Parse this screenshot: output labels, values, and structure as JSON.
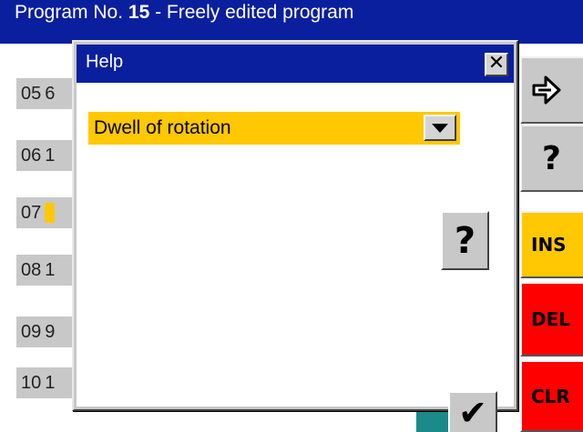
{
  "program": {
    "label": "Program No.",
    "number": "15",
    "name": "- Freely edited program"
  },
  "rows": [
    {
      "index": "05",
      "value": "6"
    },
    {
      "index": "06",
      "value": "1"
    },
    {
      "index": "07",
      "value": "l",
      "highlight": true
    },
    {
      "index": "08",
      "value": "1"
    },
    {
      "index": "09",
      "value": "9"
    },
    {
      "index": "10",
      "value": "1"
    }
  ],
  "side_buttons": {
    "enter_icon": "arrow-enter-icon",
    "help_label": "?",
    "ins_label": "INS",
    "del_label": "DEL",
    "clr_label": "CLR"
  },
  "dialog": {
    "title": "Help",
    "close_glyph": "✕",
    "dropdown_value": "Dwell of rotation",
    "help_label": "?",
    "ok_glyph": "✔"
  },
  "colors": {
    "title_blue": "#0a1f9e",
    "highlight_yellow": "#ffc800",
    "button_grey": "#c8c8c8",
    "del_red": "#ff0000",
    "teal": "#1a8a8a"
  }
}
